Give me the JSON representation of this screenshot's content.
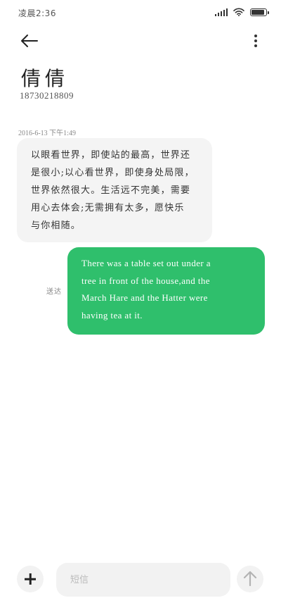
{
  "status_bar": {
    "time": "凌晨2:36",
    "icons": [
      "signal-icon",
      "wifi-icon",
      "battery-icon"
    ],
    "battery_level": 0.9
  },
  "header": {
    "back_icon": "arrow-left-icon",
    "more_icon": "more-vertical-icon",
    "contact_name": "倩倩",
    "contact_number": "18730218809"
  },
  "messages": [
    {
      "direction": "incoming",
      "timestamp": "2016-6-13 下午1:49",
      "text": "以眼看世界，即使站的最高，世界还\n是很小;以心看世界，即使身处局限，\n世界依然很大。生活远不完美，需要\n用心去体会;无需拥有太多，愿快乐\n与你相随。"
    },
    {
      "direction": "outgoing",
      "status": "送达",
      "text": "There was a table set out under a\ntree in front of the house,and the\nMarch Hare and the Hatter were\nhaving tea at it."
    }
  ],
  "composer": {
    "attach_icon": "plus-icon",
    "placeholder": "短信",
    "value": "",
    "send_icon": "arrow-up-icon"
  },
  "colors": {
    "outgoing_bubble": "#2fbf6c",
    "incoming_bubble": "#f4f4f4",
    "composer_bg": "#f2f2f2"
  }
}
